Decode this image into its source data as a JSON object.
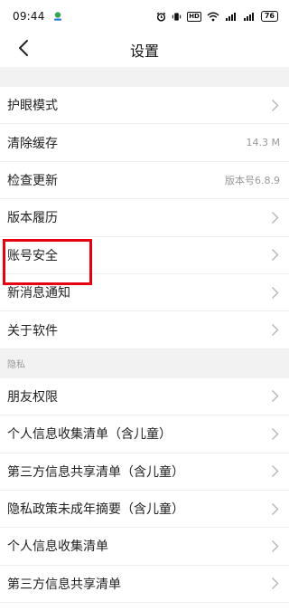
{
  "status_bar": {
    "time": "09:44",
    "network_label": "HD",
    "battery": "76"
  },
  "nav": {
    "title": "设置"
  },
  "sections": [
    {
      "header": "",
      "items": [
        {
          "label": "护眼模式",
          "value": "",
          "chevron": true
        },
        {
          "label": "清除缓存",
          "value": "14.3 M",
          "chevron": false
        },
        {
          "label": "检查更新",
          "value": "版本号6.8.9",
          "chevron": false
        },
        {
          "label": "版本履历",
          "value": "",
          "chevron": true
        },
        {
          "label": "账号安全",
          "value": "",
          "chevron": true
        },
        {
          "label": "新消息通知",
          "value": "",
          "chevron": true
        },
        {
          "label": "关于软件",
          "value": "",
          "chevron": true
        }
      ]
    },
    {
      "header": "隐私",
      "items": [
        {
          "label": "朋友权限",
          "value": "",
          "chevron": true
        },
        {
          "label": "个人信息收集清单（含儿童）",
          "value": "",
          "chevron": true
        },
        {
          "label": "第三方信息共享清单（含儿童）",
          "value": "",
          "chevron": true
        },
        {
          "label": "隐私政策未成年摘要（含儿童）",
          "value": "",
          "chevron": true
        },
        {
          "label": "个人信息收集清单",
          "value": "",
          "chevron": true
        },
        {
          "label": "第三方信息共享清单",
          "value": "",
          "chevron": true
        }
      ]
    }
  ],
  "colors": {
    "highlight": "#e60012",
    "section_bg": "#f2f2f2",
    "secondary_text": "#999999"
  },
  "icons": {
    "back": "chevron-left-icon",
    "row": "chevron-right-icon"
  }
}
